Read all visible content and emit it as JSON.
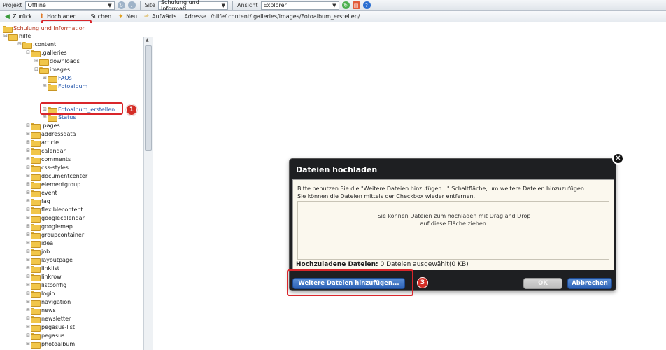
{
  "topbar": {
    "projekt_label": "Projekt",
    "projekt_value": "Offline",
    "site_label": "Site",
    "site_value": "Schulung und Informati",
    "ansicht_label": "Ansicht",
    "ansicht_value": "Explorer"
  },
  "toolbar": {
    "back_label": "Zurück",
    "upload_label": "Hochladen",
    "search_label": "Suchen",
    "new_label": "Neu",
    "up_label": "Aufwärts",
    "address_label": "Adresse",
    "address_value": "/hilfe/.content/.galleries/images/Fotoalbum_erstellen/"
  },
  "sidebar": {
    "root": "Schulung und Information",
    "items": [
      "hilfe",
      ".content",
      ".galleries",
      "downloads",
      "images",
      "FAQs",
      "Fotoalbum",
      "Fotoalbum_erstellen",
      "Status",
      ".pages",
      "addressdata",
      "article",
      "calendar",
      "comments",
      "css-styles",
      "documentcenter",
      "elementgroup",
      "event",
      "faq",
      "flexiblecontent",
      "googlecalendar",
      "googlemap",
      "groupcontainer",
      "idea",
      "job",
      "layoutpage",
      "linklist",
      "linkrow",
      "listconfig",
      "login",
      "navigation",
      "news",
      "newsletter",
      "pegasus-list",
      "pegasus",
      "photoalbum"
    ]
  },
  "dialog": {
    "title": "Dateien hochladen",
    "instruction": "Bitte benutzen Sie die \"Weitere Dateien hinzufügen...\" Schaltfläche, um weitere Dateien hinzuzufügen. Sie können die Dateien mittels der Checkbox wieder entfernen.",
    "dropzone_line1": "Sie können Dateien zum hochladen mit Drag and Drop",
    "dropzone_line2": "auf diese Fläche ziehen.",
    "status_label": "Hochzuladene Dateien:",
    "status_value": "0 Dateien ausgewählt(0 KB)",
    "add_button": "Weitere Dateien hinzufügen...",
    "ok_button": "OK",
    "cancel_button": "Abbrechen"
  },
  "badges": {
    "one": "1",
    "two": "2",
    "three": "3"
  },
  "colors": {
    "highlight": "#d9262b",
    "dialog_bg": "#1e1f22",
    "button_blue": "#2d62b6"
  }
}
